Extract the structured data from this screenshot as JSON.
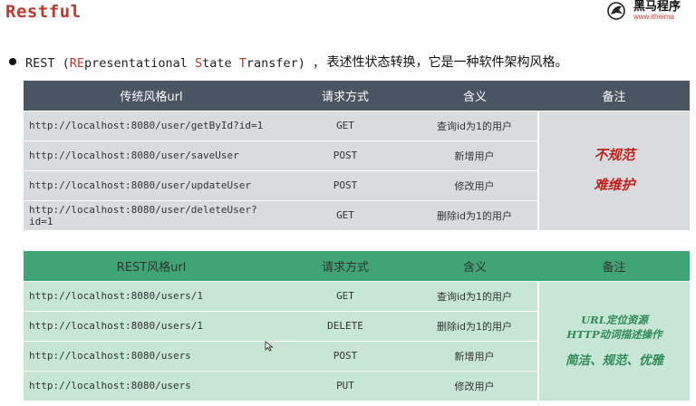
{
  "header": {
    "title": "Restful",
    "logo_cn": "黑马程序",
    "logo_url": "www.itheima"
  },
  "intro": {
    "prefix": "REST (",
    "r1": "RE",
    "p1": "presentational ",
    "r2": "S",
    "p2": "tate ",
    "r3": "T",
    "p3": "ransfer) ，",
    "description": "表述性状态转换，它是一种软件架构风格。"
  },
  "traditional_table": {
    "headers": [
      "传统风格url",
      "请求方式",
      "含义",
      "备注"
    ],
    "rows": [
      {
        "url": "http://localhost:8080/user/getById?id=1",
        "method": "GET",
        "meaning": "查询id为1的用户"
      },
      {
        "url": "http://localhost:8080/user/saveUser",
        "method": "POST",
        "meaning": "新增用户"
      },
      {
        "url": "http://localhost:8080/user/updateUser",
        "method": "POST",
        "meaning": "修改用户"
      },
      {
        "url": "http://localhost:8080/user/deleteUser?id=1",
        "method": "GET",
        "meaning": "删除id为1的用户"
      }
    ],
    "note_lines": [
      "不规范",
      "难维护"
    ]
  },
  "rest_table": {
    "headers": [
      "REST风格url",
      "请求方式",
      "含义",
      "备注"
    ],
    "rows": [
      {
        "url": "http://localhost:8080/users/1",
        "method": "GET",
        "meaning": "查询id为1的用户"
      },
      {
        "url": "http://localhost:8080/users/1",
        "method": "DELETE",
        "meaning": "删除id为1的用户"
      },
      {
        "url": "http://localhost:8080/users",
        "method": "POST",
        "meaning": "新增用户"
      },
      {
        "url": "http://localhost:8080/users",
        "method": "PUT",
        "meaning": "修改用户"
      }
    ],
    "note_lines": [
      "URL定位资源",
      "HTTP动词描述操作",
      "简洁、规范、优雅"
    ]
  },
  "colors": {
    "title_red": "#c0392b",
    "traditional_header": "#4a5563",
    "traditional_row": "#d9dcdf",
    "rest_header": "#3fa574",
    "rest_row": "#c7e6d6",
    "note_red": "#c0201a",
    "note_green": "#2e8b57"
  }
}
